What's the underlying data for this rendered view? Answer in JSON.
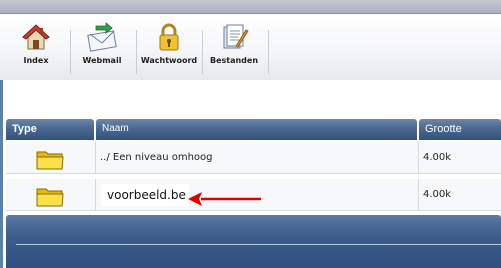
{
  "toolbar": {
    "items": [
      {
        "label": "Index",
        "icon": "house-icon"
      },
      {
        "label": "Webmail",
        "icon": "mail-icon"
      },
      {
        "label": "Wachtwoord",
        "icon": "lock-icon"
      },
      {
        "label": "Bestanden",
        "icon": "files-icon"
      }
    ]
  },
  "table": {
    "headers": {
      "type": "Type",
      "naam": "Naam",
      "grootte": "Grootte"
    },
    "rows": [
      {
        "type_icon": "folder-icon",
        "naam": "../ Een niveau omhoog",
        "grootte": "4.00k"
      },
      {
        "type_icon": "folder-icon",
        "naam": "voorbeeld.be",
        "grootte": "4.00k"
      }
    ]
  },
  "colors": {
    "header": "#4a6890",
    "annotation_arrow": "#e00000"
  }
}
